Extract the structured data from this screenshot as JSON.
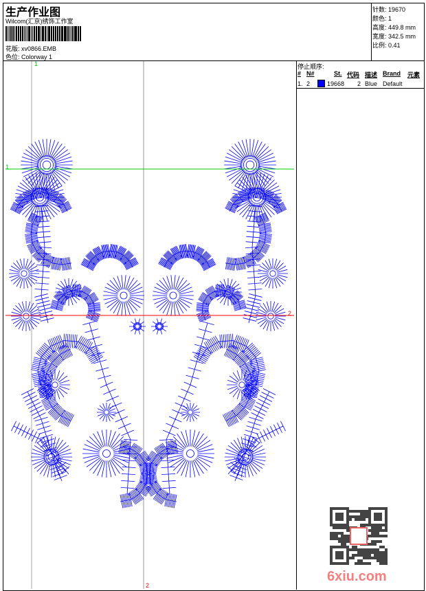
{
  "header": {
    "title": "生产作业图",
    "company": "Wilcom(汇京)绣饰工作室",
    "design_label": "花版:",
    "design_value": "xv0866.EMB",
    "colorway_label": "色位:",
    "colorway_value": "Colorway 1"
  },
  "info": {
    "stitches": "针数: 19670",
    "colors": "颜色: 1",
    "height": "高度: 449.8 mm",
    "width": "宽度: 342.5 mm",
    "scale": "比例: 0.41"
  },
  "stop_sequence": {
    "title": "停止顺序:",
    "columns": [
      "#",
      "N#",
      "St.",
      "代码",
      "描述",
      "Brand",
      "元素"
    ],
    "rows": [
      {
        "index": "1.",
        "needle": "2",
        "color": "#0000ff",
        "stitches": "19668",
        "code": "2",
        "description": "Blue",
        "brand": "Default"
      }
    ]
  },
  "guides": {
    "green_label_top": "1",
    "green_label_left": "1",
    "red_label_right": "2",
    "red_label_bottom": "2",
    "green": "#00cc00",
    "red": "#ff0000"
  },
  "design_color": "#0000ff",
  "watermark": {
    "text": "6xiu.com",
    "stamp": "以图制版"
  }
}
